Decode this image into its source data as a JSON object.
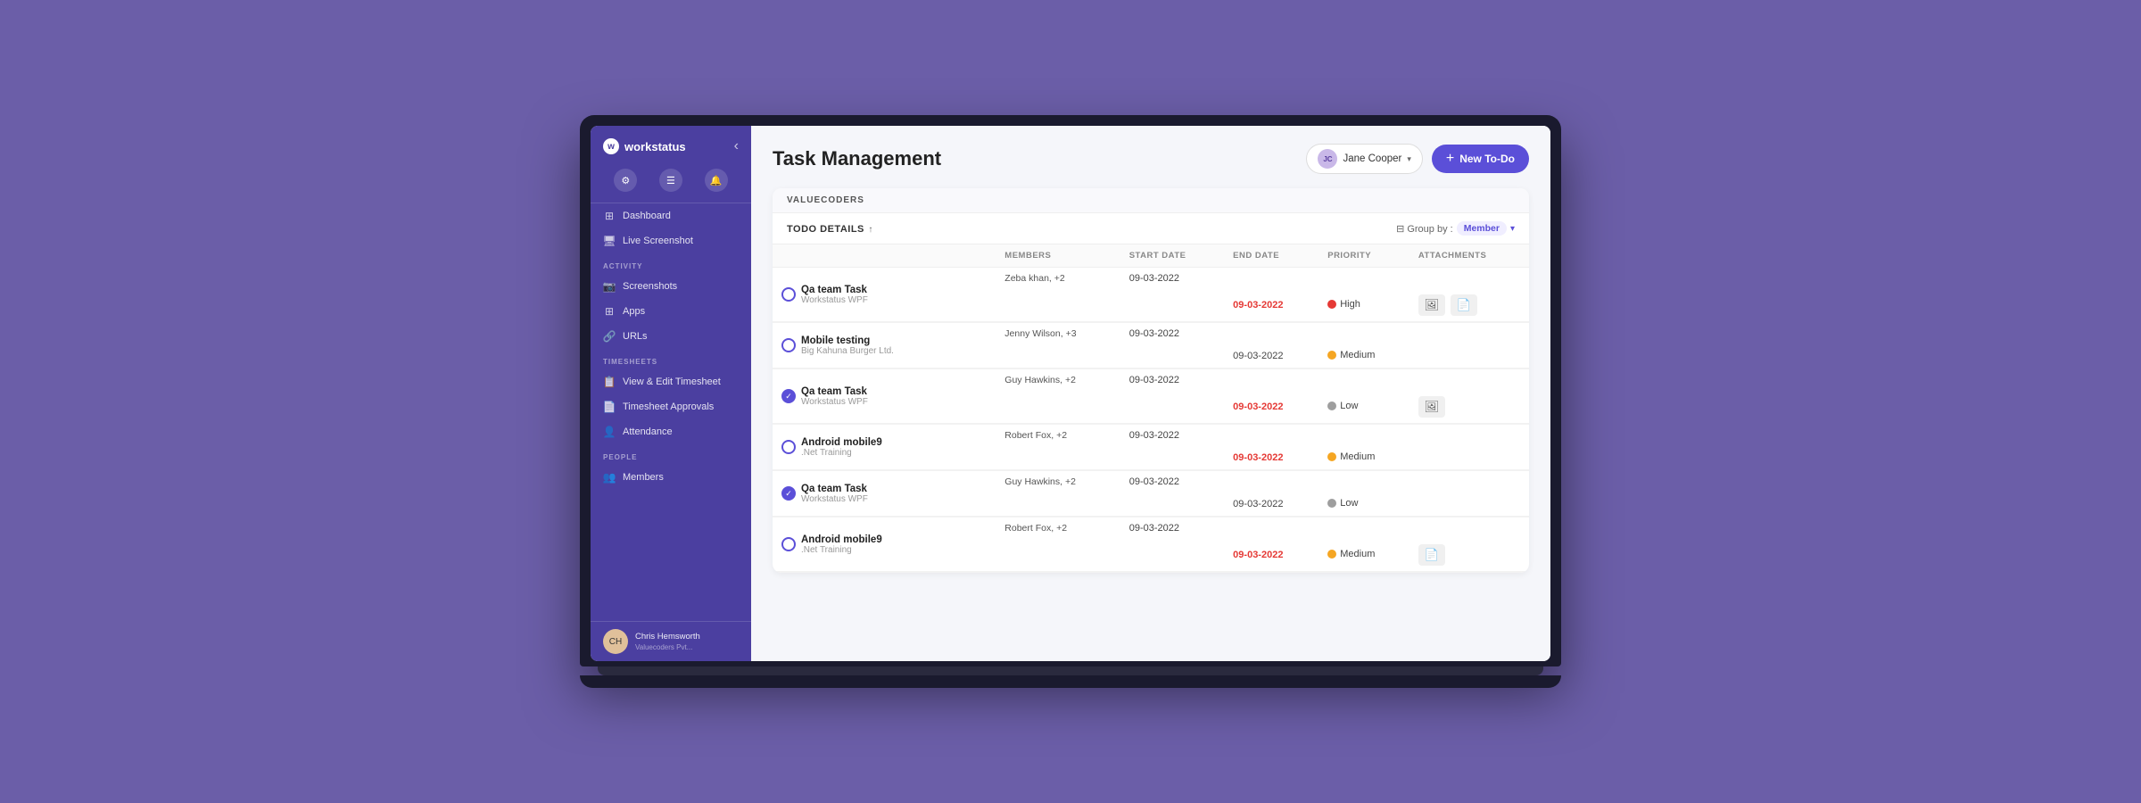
{
  "app": {
    "name": "workstatus",
    "title": "Task Management"
  },
  "sidebar": {
    "collapse_btn": "‹",
    "icons": [
      "⚙",
      "☰",
      "🔔"
    ],
    "sections": [
      {
        "label": "",
        "items": [
          {
            "id": "dashboard",
            "icon": "⊞",
            "label": "Dashboard"
          },
          {
            "id": "live-screenshot",
            "icon": "🖥",
            "label": "Live Screenshot"
          }
        ]
      },
      {
        "label": "ACTIVITY",
        "items": [
          {
            "id": "screenshots",
            "icon": "📷",
            "label": "Screenshots"
          },
          {
            "id": "apps",
            "icon": "⊞",
            "label": "Apps"
          },
          {
            "id": "urls",
            "icon": "🔗",
            "label": "URLs"
          }
        ]
      },
      {
        "label": "TIMESHEETS",
        "items": [
          {
            "id": "view-edit-timesheet",
            "icon": "📋",
            "label": "View & Edit Timesheet"
          },
          {
            "id": "timesheet-approvals",
            "icon": "📄",
            "label": "Timesheet Approvals"
          },
          {
            "id": "attendance",
            "icon": "👤",
            "label": "Attendance"
          }
        ]
      },
      {
        "label": "PEOPLE",
        "items": [
          {
            "id": "members",
            "icon": "👥",
            "label": "Members"
          }
        ]
      }
    ],
    "user": {
      "name": "Chris Hemsworth",
      "org": "Valuecoders Pvt..."
    }
  },
  "header": {
    "page_title": "Task Management",
    "user_selector_name": "Jane Cooper",
    "new_todo_label": "+ New To-Do"
  },
  "table": {
    "group_label": "VALUECODERS",
    "todo_details_label": "TODO DETAILS",
    "sort_indicator": "↑",
    "group_by_label": "Group by :",
    "group_by_value": "Member",
    "columns": {
      "members": "MEMBERS",
      "start_date": "START DATE",
      "end_date": "END DATE",
      "priority": "PRIORITY",
      "attachments": "ATTACHMENTS"
    },
    "tasks": [
      {
        "id": 1,
        "checked": false,
        "title": "Qa team Task",
        "subtitle": "Workstatus WPF",
        "members": "Zeba khan, +2",
        "start_date": "09-03-2022",
        "end_date": "09-03-2022",
        "end_date_overdue": true,
        "priority": "High",
        "priority_level": "high",
        "has_attachments": true,
        "attachment_types": [
          "image",
          "doc"
        ]
      },
      {
        "id": 2,
        "checked": false,
        "title": "Mobile testing",
        "subtitle": "Big Kahuna Burger Ltd.",
        "members": "Jenny Wilson, +3",
        "start_date": "09-03-2022",
        "end_date": "09-03-2022",
        "end_date_overdue": false,
        "priority": "Medium",
        "priority_level": "medium",
        "has_attachments": false,
        "attachment_types": []
      },
      {
        "id": 3,
        "checked": true,
        "title": "Qa team Task",
        "subtitle": "Workstatus WPF",
        "members": "Guy Hawkins, +2",
        "start_date": "09-03-2022",
        "end_date": "09-03-2022",
        "end_date_overdue": true,
        "priority": "Low",
        "priority_level": "low",
        "has_attachments": true,
        "attachment_types": [
          "image"
        ]
      },
      {
        "id": 4,
        "checked": false,
        "title": "Android mobile9",
        "subtitle": ".Net Training",
        "members": "Robert Fox, +2",
        "start_date": "09-03-2022",
        "end_date": "09-03-2022",
        "end_date_overdue": true,
        "priority": "Medium",
        "priority_level": "medium",
        "has_attachments": false,
        "attachment_types": []
      },
      {
        "id": 5,
        "checked": true,
        "title": "Qa team Task",
        "subtitle": "Workstatus WPF",
        "members": "Guy Hawkins, +2",
        "start_date": "09-03-2022",
        "end_date": "09-03-2022",
        "end_date_overdue": false,
        "priority": "Low",
        "priority_level": "low",
        "has_attachments": false,
        "attachment_types": []
      },
      {
        "id": 6,
        "checked": false,
        "title": "Android mobile9",
        "subtitle": ".Net Training",
        "members": "Robert Fox, +2",
        "start_date": "09-03-2022",
        "end_date": "09-03-2022",
        "end_date_overdue": true,
        "priority": "Medium",
        "priority_level": "medium",
        "has_attachments": true,
        "attachment_types": [
          "doc"
        ]
      }
    ]
  }
}
